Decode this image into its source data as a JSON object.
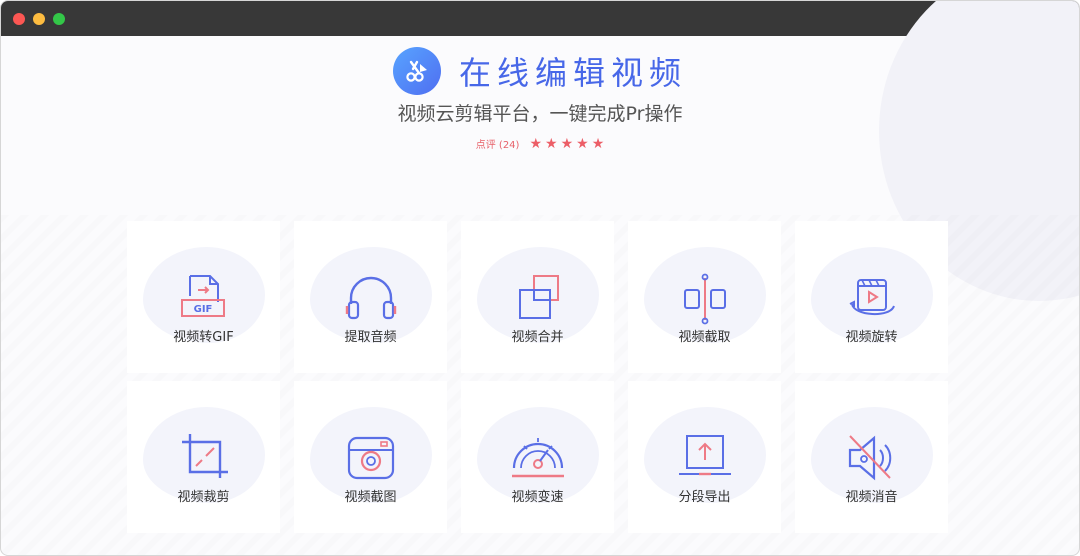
{
  "app": {
    "title": "在线编辑视频",
    "subtitle": "视频云剪辑平台，一键完成Pr操作",
    "rating_label": "点评 (24)",
    "rating_stars": 5
  },
  "tools": [
    {
      "label": "视频转GIF",
      "icon": "gif-convert-icon"
    },
    {
      "label": "提取音频",
      "icon": "headphones-icon"
    },
    {
      "label": "视频合并",
      "icon": "merge-icon"
    },
    {
      "label": "视频截取",
      "icon": "split-icon"
    },
    {
      "label": "视频旋转",
      "icon": "rotate-icon"
    },
    {
      "label": "视频裁剪",
      "icon": "crop-icon"
    },
    {
      "label": "视频截图",
      "icon": "camera-icon"
    },
    {
      "label": "视频变速",
      "icon": "speed-icon"
    },
    {
      "label": "分段导出",
      "icon": "export-icon"
    },
    {
      "label": "视频消音",
      "icon": "mute-icon"
    }
  ],
  "colors": {
    "accent": "#4767e8",
    "secondary": "#ee7a86",
    "star": "#ec5e67"
  }
}
